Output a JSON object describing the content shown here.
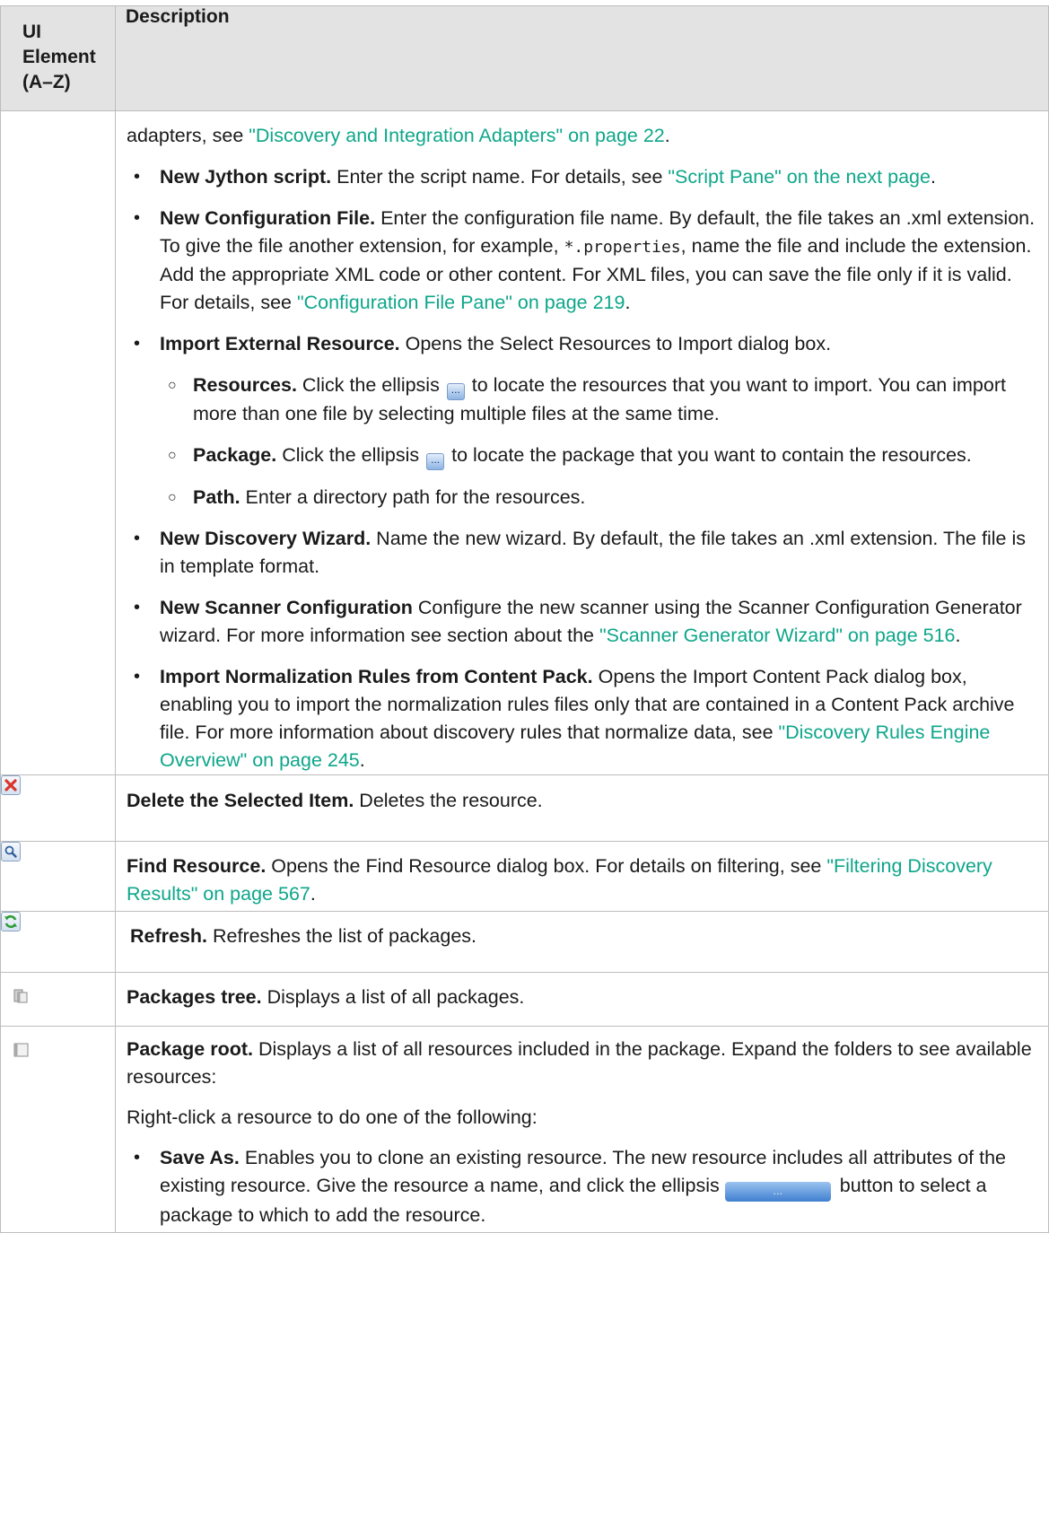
{
  "header": {
    "col1_line1": "UI",
    "col1_line2": "Element",
    "col1_line3": "(A–Z)",
    "col2": "Description"
  },
  "row_new": {
    "intro_text": "adapters, see ",
    "intro_link": "\"Discovery and Integration Adapters\" on page 22",
    "intro_end": ".",
    "jython_title": "New Jython script.",
    "jython_text": " Enter the script name. For details, see ",
    "jython_link": "\"Script Pane\" on the next page",
    "jython_end": ".",
    "config_title": "New Configuration File.",
    "config_text1": " Enter the configuration file name. By default, the file takes an .xml extension. To give the file another extension, for example, ",
    "config_code": "*.properties",
    "config_text2": ", name the file and include the extension. Add the appropriate XML code or other content. For XML files, you can save the file only if it is valid. For details, see ",
    "config_link": "\"Configuration File Pane\" on page 219",
    "config_end": ".",
    "import_title": "Import External Resource.",
    "import_text": " Opens the Select Resources to Import dialog box.",
    "resources_title": "Resources.",
    "resources_text1": " Click the ellipsis ",
    "resources_text2": " to locate the resources that you want to import. You can import more than one file by selecting multiple files at the same time.",
    "package_title": "Package.",
    "package_text1": " Click the ellipsis ",
    "package_text2": " to locate the package that you want to contain the resources.",
    "path_title": "Path.",
    "path_text": " Enter a directory path for the resources.",
    "wizard_title": "New Discovery Wizard.",
    "wizard_text": " Name the new wizard. By default, the file takes an .xml extension. The file is in template format.",
    "scanner_title": "New Scanner Configuration",
    "scanner_text": " Configure the new scanner using the Scanner Configuration Generator wizard. For more information see section about the ",
    "scanner_link": "\"Scanner Generator Wizard\" on page 516",
    "scanner_end": ".",
    "norm_title": "Import Normalization Rules from Content Pack.",
    "norm_text": " Opens the Import Content Pack dialog box, enabling you to import the normalization rules files only that are contained in a Content Pack archive file. For more information about discovery rules that normalize data, see ",
    "norm_link": "\"Discovery Rules Engine Overview\" on page 245",
    "norm_end": ".",
    "ellipsis": "..."
  },
  "row_delete": {
    "title": "Delete the Selected Item.",
    "text": " Deletes the resource.",
    "icon": "delete-x-icon"
  },
  "row_find": {
    "title": "Find Resource.",
    "text": " Opens the Find Resource dialog box. For details on filtering, see ",
    "link": "\"Filtering Discovery Results\" on page 567",
    "end": ".",
    "icon": "magnifier-icon"
  },
  "row_refresh": {
    "title": "Refresh.",
    "text": " Refreshes the list of packages.",
    "icon": "refresh-icon"
  },
  "row_tree": {
    "title": "Packages tree.",
    "text": " Displays a list of all packages.",
    "icon": "packages-tree-icon"
  },
  "row_root": {
    "title": "Package root.",
    "text": " Displays a list of all resources included in the package. Expand the folders to see available resources:",
    "para2": "Right-click a resource to do one of the following:",
    "saveas_title": "Save As.",
    "saveas_text1": " Enables you to clone an existing resource. The new resource includes all attributes of the existing resource. Give the resource a name, and click the ellipsis ",
    "saveas_text2": " button to select a package to which to add the resource.",
    "icon": "package-root-icon"
  },
  "colors": {
    "link": "#0ea68a",
    "header_bg": "#e3e3e3",
    "border": "#bdbdbd"
  }
}
